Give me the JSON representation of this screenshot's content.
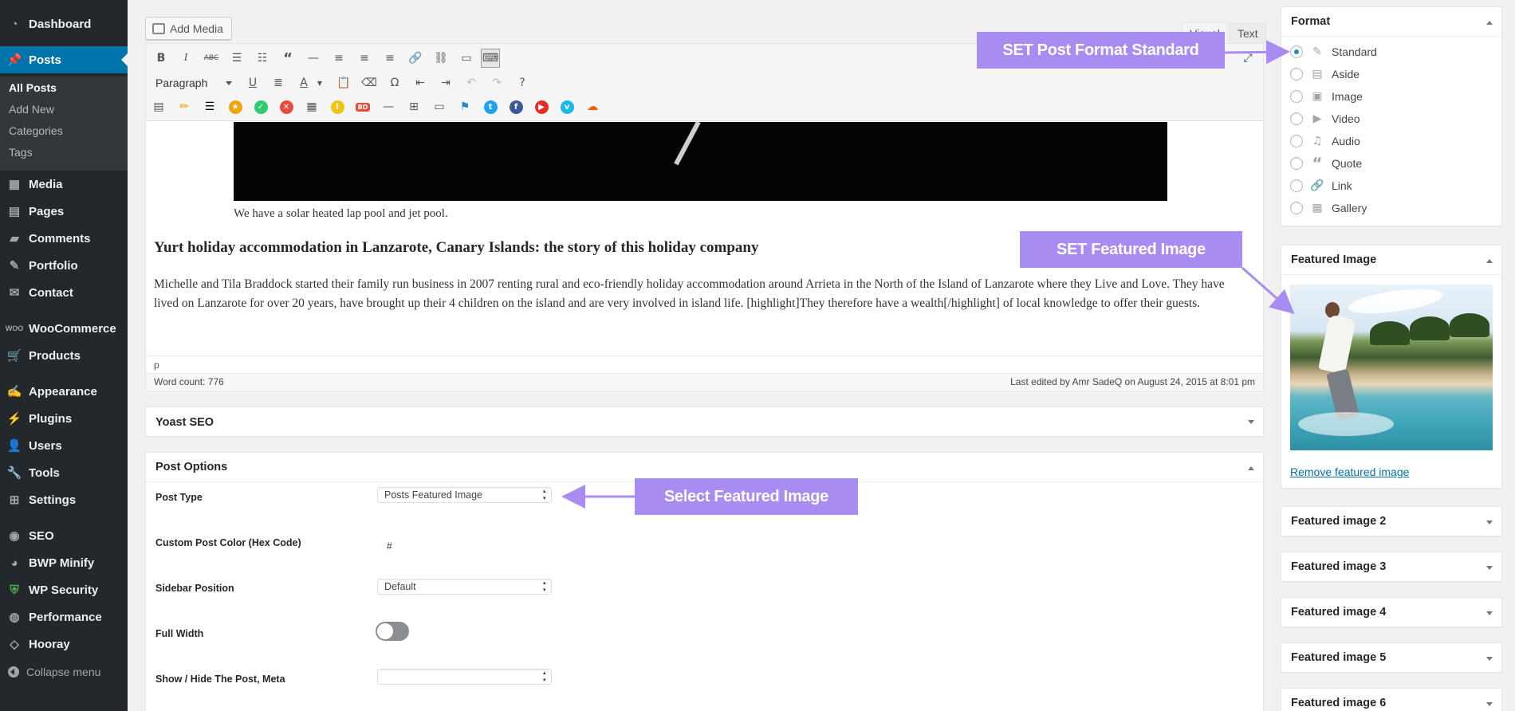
{
  "sidebar": {
    "items": [
      {
        "label": "Dashboard",
        "icon": "dashboard-icon"
      },
      {
        "label": "Posts",
        "icon": "pin-icon"
      },
      {
        "label": "Media",
        "icon": "media-icon"
      },
      {
        "label": "Pages",
        "icon": "pages-icon"
      },
      {
        "label": "Comments",
        "icon": "comments-icon"
      },
      {
        "label": "Portfolio",
        "icon": "pin-icon"
      },
      {
        "label": "Contact",
        "icon": "mail-icon"
      },
      {
        "label": "WooCommerce",
        "icon": "woo-icon"
      },
      {
        "label": "Products",
        "icon": "cart-icon"
      },
      {
        "label": "Appearance",
        "icon": "brush-icon"
      },
      {
        "label": "Plugins",
        "icon": "plugins-icon"
      },
      {
        "label": "Users",
        "icon": "users-icon"
      },
      {
        "label": "Tools",
        "icon": "tools-icon"
      },
      {
        "label": "Settings",
        "icon": "settings-icon"
      },
      {
        "label": "SEO",
        "icon": "seo-icon"
      },
      {
        "label": "BWP Minify",
        "icon": "minify-icon"
      },
      {
        "label": "WP Security",
        "icon": "shield-icon"
      },
      {
        "label": "Performance",
        "icon": "performance-icon"
      },
      {
        "label": "Hooray",
        "icon": "hooray-icon"
      }
    ],
    "submenu": [
      "All Posts",
      "Add New",
      "Categories",
      "Tags"
    ],
    "collapse_label": "Collapse menu"
  },
  "editor": {
    "add_media_label": "Add Media",
    "tab_visual": "Visual",
    "tab_text": "Text",
    "format_select": "Paragraph",
    "caption": "We have a solar heated lap pool and jet pool.",
    "heading": "Yurt holiday accommodation in Lanzarote, Canary Islands: the story of this holiday company",
    "paragraph": "Michelle and Tila Braddock started their family run business in 2007 renting rural and eco-friendly holiday accommodation around Arrieta in the North of the Island of Lanzarote where they Live and Love. They have lived on Lanzarote for over 20 years, have brought up their 4 children on the island and are very involved in island life. [highlight]They therefore have a wealth[/highlight] of local knowledge to offer their guests.",
    "path": "p",
    "word_count": "Word count: 776",
    "last_edited": "Last edited by Amr SadeQ on August 24, 2015 at 8:01 pm"
  },
  "yoast": {
    "title": "Yoast SEO"
  },
  "post_options": {
    "title": "Post Options",
    "post_type_label": "Post Type",
    "post_type_value": "Posts Featured Image",
    "color_label": "Custom Post Color (Hex Code)",
    "color_prefix": "#",
    "sidebar_label": "Sidebar Position",
    "sidebar_value": "Default",
    "full_width_label": "Full Width",
    "full_width_on": false,
    "meta_label": "Show / Hide The Post, Meta",
    "meta_value": ""
  },
  "format_box": {
    "title": "Format",
    "options": [
      {
        "label": "Standard",
        "icon": "pin-icon",
        "checked": true
      },
      {
        "label": "Aside",
        "icon": "aside-icon",
        "checked": false
      },
      {
        "label": "Image",
        "icon": "image-icon",
        "checked": false
      },
      {
        "label": "Video",
        "icon": "video-icon",
        "checked": false
      },
      {
        "label": "Audio",
        "icon": "audio-icon",
        "checked": false
      },
      {
        "label": "Quote",
        "icon": "quote-icon",
        "checked": false
      },
      {
        "label": "Link",
        "icon": "link-icon",
        "checked": false
      },
      {
        "label": "Gallery",
        "icon": "gallery-icon",
        "checked": false
      }
    ]
  },
  "featured": {
    "title": "Featured Image",
    "remove_link": "Remove featured image",
    "extra_boxes": [
      "Featured image 2",
      "Featured image 3",
      "Featured image 4",
      "Featured image 5",
      "Featured image 6"
    ]
  },
  "annotations": {
    "format": "SET Post Format Standard",
    "featured": "SET Featured Image",
    "select": "Select Featured Image"
  },
  "colors": {
    "sidebar_bg": "#23282d",
    "active_blue": "#0073aa",
    "callout_purple": "#a98cf2"
  }
}
